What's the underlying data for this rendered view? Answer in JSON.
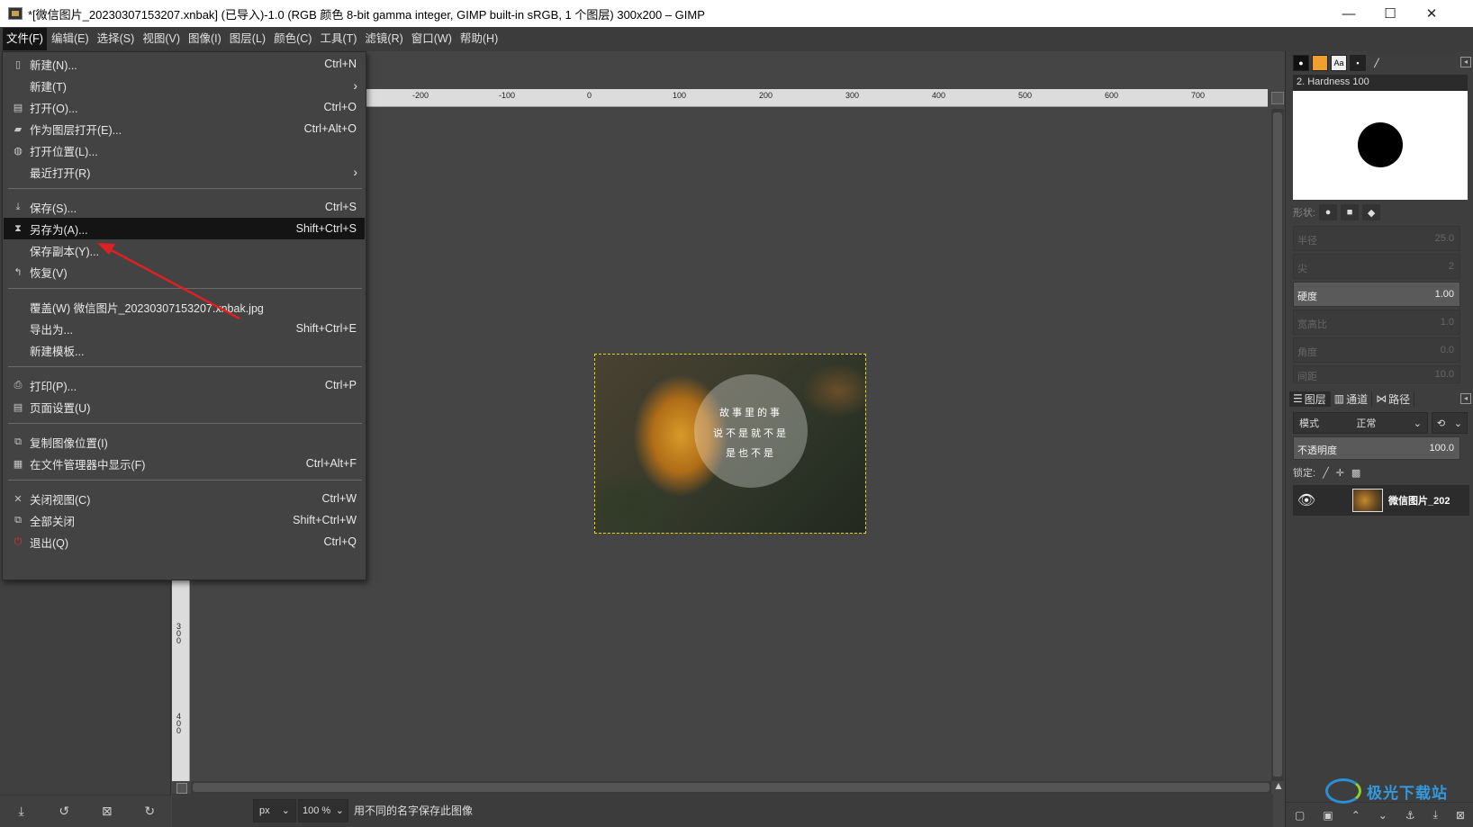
{
  "window": {
    "title": "*[微信图片_20230307153207.xnbak] (已导入)-1.0 (RGB 颜色 8-bit gamma integer, GIMP built-in sRGB, 1 个图层) 300x200 – GIMP",
    "minimize": "—",
    "maximize": "☐",
    "close": "✕"
  },
  "menubar": [
    {
      "label": "文件(F)"
    },
    {
      "label": "编辑(E)"
    },
    {
      "label": "选择(S)"
    },
    {
      "label": "视图(V)"
    },
    {
      "label": "图像(I)"
    },
    {
      "label": "图层(L)"
    },
    {
      "label": "颜色(C)"
    },
    {
      "label": "工具(T)"
    },
    {
      "label": "滤镜(R)"
    },
    {
      "label": "窗口(W)"
    },
    {
      "label": "帮助(H)"
    }
  ],
  "file_menu": [
    {
      "label": "新建(N)...",
      "shortcut": "Ctrl+N",
      "icon": "new-file-icon"
    },
    {
      "label": "新建(T)",
      "shortcut": "",
      "submenu": true
    },
    {
      "label": "打开(O)...",
      "shortcut": "Ctrl+O",
      "icon": "open-icon"
    },
    {
      "label": "作为图层打开(E)...",
      "shortcut": "Ctrl+Alt+O",
      "icon": "open-as-layer-icon"
    },
    {
      "label": "打开位置(L)...",
      "shortcut": "",
      "icon": "open-location-icon"
    },
    {
      "label": "最近打开(R)",
      "shortcut": "",
      "submenu": true
    },
    {
      "label": "保存(S)...",
      "shortcut": "Ctrl+S",
      "icon": "save-icon"
    },
    {
      "label": "另存为(A)...",
      "shortcut": "Shift+Ctrl+S",
      "icon": "save-as-icon",
      "highlighted": true
    },
    {
      "label": "保存副本(Y)...",
      "shortcut": ""
    },
    {
      "label": "恢复(V)",
      "shortcut": "",
      "icon": "revert-icon"
    },
    {
      "label": "覆盖(W) 微信图片_20230307153207.xnbak.jpg",
      "shortcut": ""
    },
    {
      "label": "导出为...",
      "shortcut": "Shift+Ctrl+E"
    },
    {
      "label": "新建模板...",
      "shortcut": ""
    },
    {
      "label": "打印(P)...",
      "shortcut": "Ctrl+P",
      "icon": "print-icon"
    },
    {
      "label": "页面设置(U)",
      "shortcut": "",
      "icon": "page-setup-icon"
    },
    {
      "label": "复制图像位置(I)",
      "shortcut": "",
      "icon": "copy-location-icon"
    },
    {
      "label": "在文件管理器中显示(F)",
      "shortcut": "Ctrl+Alt+F",
      "icon": "file-manager-icon"
    },
    {
      "label": "关闭视图(C)",
      "shortcut": "Ctrl+W",
      "icon": "close-view-icon"
    },
    {
      "label": "全部关闭",
      "shortcut": "Shift+Ctrl+W",
      "icon": "close-all-icon"
    },
    {
      "label": "退出(Q)",
      "shortcut": "Ctrl+Q",
      "icon": "quit-icon"
    }
  ],
  "ruler_h": [
    "-200",
    "-100",
    "0",
    "100",
    "200",
    "300",
    "400",
    "500",
    "600",
    "700"
  ],
  "ruler_v": [
    "300",
    "400"
  ],
  "image": {
    "lines": [
      "故事里的事",
      "说不是就不是",
      "是也不是"
    ]
  },
  "statusbar": {
    "unit": "px",
    "zoom": "100 %",
    "message": "用不同的名字保存此图像"
  },
  "brushes": {
    "selected_name": "2. Hardness 100",
    "shape_label": "形状:",
    "sliders": [
      {
        "label": "半径",
        "value": "25.0"
      },
      {
        "label": "尖",
        "value": "2"
      },
      {
        "label": "硬度",
        "value": "1.00",
        "active": true
      },
      {
        "label": "宽高比",
        "value": "1.0"
      },
      {
        "label": "角度",
        "value": "0.0"
      },
      {
        "label": "间距",
        "value": "10.0"
      }
    ]
  },
  "layers": {
    "tabs": [
      "图层",
      "通道",
      "路径"
    ],
    "mode_label": "模式",
    "mode_value": "正常",
    "opacity_label": "不透明度",
    "opacity_value": "100.0",
    "lock_label": "锁定:",
    "layer_name": "微信图片_202"
  },
  "watermark": {
    "text": "极光下载站"
  },
  "colors": {
    "menu_highlight": "#141414",
    "arrow": "#e02020",
    "selection": "#e6d800"
  }
}
